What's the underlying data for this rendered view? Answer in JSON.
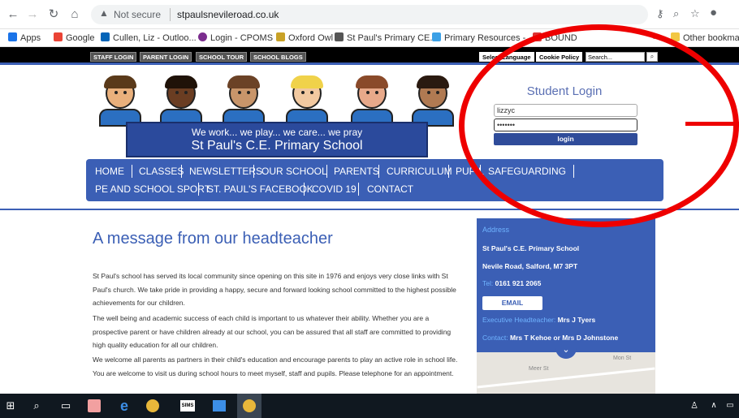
{
  "browser": {
    "security_label": "Not secure",
    "url": "stpaulsnevileroad.co.uk",
    "bookmarks": [
      "Apps",
      "Google",
      "Cullen, Liz - Outloo...",
      "Login - CPOMS",
      "Oxford Owl",
      "St Paul's Primary CE...",
      "Primary Resources -...",
      "BOUND",
      "»",
      "Other bookmarks"
    ]
  },
  "topbar": {
    "left_buttons": [
      "STAFF LOGIN",
      "PARENT LOGIN",
      "SCHOOL TOUR",
      "SCHOOL BLOGS"
    ],
    "right_buttons": [
      "Select Language",
      "Cookie Policy"
    ],
    "search_value": "Search..."
  },
  "banner": {
    "line1": "We work... we play... we care... we pray",
    "line2": "St Paul's C.E. Primary School"
  },
  "login": {
    "title": "Student Login",
    "username": "lizzyc",
    "password": "•••••••",
    "button": "login"
  },
  "nav": {
    "row1": [
      "HOME",
      "CLASSES",
      "NEWSLETTERS",
      "OUR SCHOOL",
      "PARENTS",
      "CURRICULUM",
      "PUPIL",
      "SAFEGUARDING"
    ],
    "row2": [
      "PE AND SCHOOL SPORT",
      "ST. PAUL'S FACEBOOK",
      "COVID 19",
      "CONTACT"
    ]
  },
  "content": {
    "title": "A message from our headteacher",
    "paragraphs": [
      "St Paul's school has served its local community since opening on this site in 1976 and enjoys very close links with St Paul's church. We take pride in providing a happy, secure and forward looking school committed to the highest possible achievements for our children.",
      "The well being and academic success of each child is important to us whatever their ability. Whether you are a prospective parent or have children already at our school, you can be assured that all staff are committed to providing high quality education for all our children.",
      "We welcome all parents as partners in their child's education and encourage parents to play an active role in school life. You are welcome to visit us during school hours to meet myself, staff and pupils. Please telephone for an appointment."
    ]
  },
  "address": {
    "heading": "Address",
    "school": "St Paul's C.E. Primary School",
    "street": "Nevile Road, Salford, M7 3PT",
    "tel_label": "Tel:",
    "tel": "0161 921 2065",
    "email_button": "EMAIL",
    "head_label": "Executive Headteacher:",
    "head": "Mrs J Tyers",
    "contact_label": "Contact:",
    "contact": "Mrs T Kehoe or Mrs D Johnstone",
    "map_labels": [
      "Meer St",
      "Mon St"
    ]
  },
  "taskbar": {
    "sims": "SIMS"
  },
  "colors": {
    "brand_blue": "#3b5fb5",
    "annotation_red": "#ee0000"
  }
}
